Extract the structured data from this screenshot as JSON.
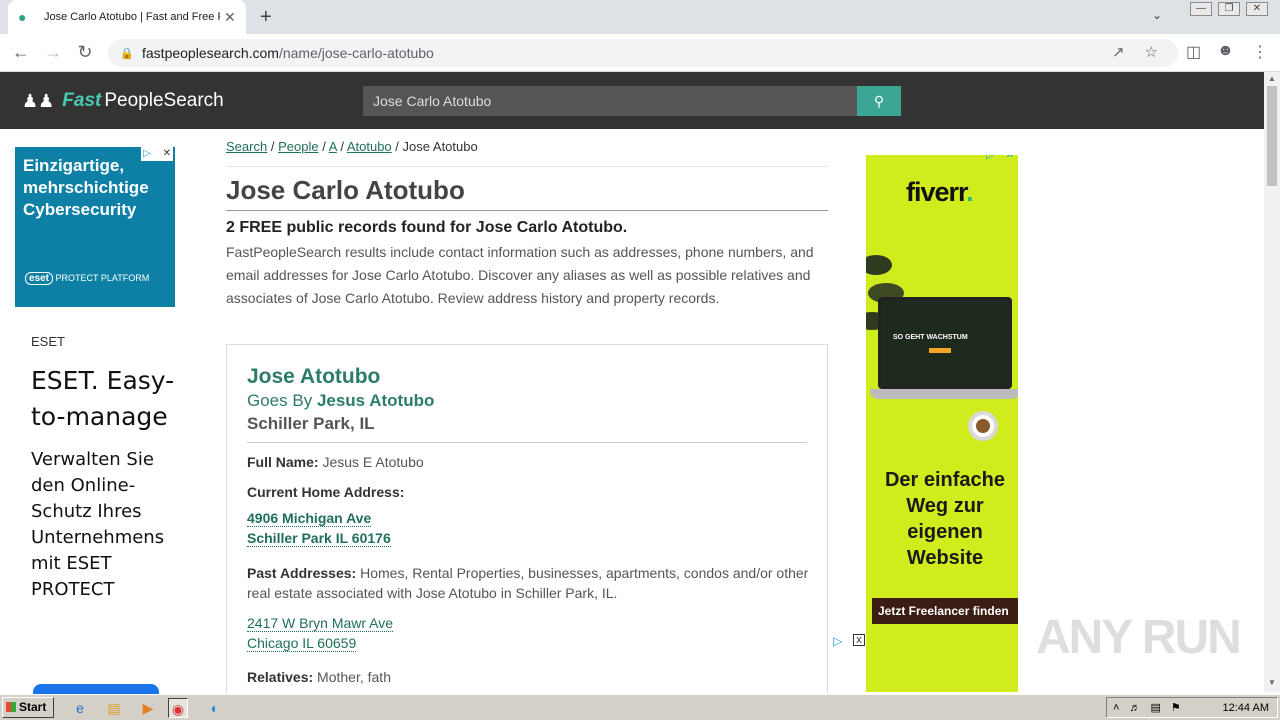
{
  "browser": {
    "tab_title": "Jose Carlo Atotubo | Fast and Free P",
    "url_host": "fastpeoplesearch.com",
    "url_path": "/name/jose-carlo-atotubo"
  },
  "site": {
    "logo_fast": "Fast",
    "logo_rest": "PeopleSearch",
    "search_value": "Jose Carlo Atotubo"
  },
  "breadcrumb": {
    "search": "Search",
    "people": "People",
    "letter": "A",
    "surname": "Atotubo",
    "current": "Jose Atotubo",
    "sep": "/"
  },
  "page": {
    "title": "Jose Carlo Atotubo",
    "subtitle": "2 FREE public records found for Jose Carlo Atotubo.",
    "intro": "FastPeopleSearch results include contact information such as addresses, phone numbers, and email addresses for Jose Carlo Atotubo. Discover any aliases as well as possible relatives and associates of Jose Carlo Atotubo. Review address history and property records."
  },
  "record": {
    "name": "Jose Atotubo",
    "goes_by_label": "Goes By",
    "goes_by_name": "Jesus Atotubo",
    "location": "Schiller Park, IL",
    "full_name_label": "Full Name:",
    "full_name": "Jesus E Atotubo",
    "current_address_label": "Current Home Address:",
    "current_address_line1": "4906 Michigan Ave",
    "current_address_line2": "Schiller Park IL 60176",
    "past_label": "Past Addresses:",
    "past_text": "Homes, Rental Properties, businesses, apartments, condos and/or other real estate associated with Jose Atotubo in Schiller Park, IL.",
    "past_line1": "2417 W Bryn Mawr Ave",
    "past_line2": "Chicago IL 60659",
    "relatives_label": "Relatives:",
    "relatives_text": "Mother, fath"
  },
  "ad_left": {
    "headline": "Einzigartige, mehrschichtige Cybersecurity",
    "logo_badge": "eset",
    "logo_text": "PROTECT PLATFORM",
    "brand": "ESET",
    "big": "ESET. Easy-to-manage",
    "body": "Verwalten Sie den Online-Schutz Ihres Unternehmens mit ESET PROTECT"
  },
  "ad_right": {
    "brand": "fiverr",
    "brand_dot": ".",
    "screen_text": "SO GEHT WACHSTUM",
    "slogan": "Der einfache Weg zur eigenen Website",
    "cta": "Jetzt Freelancer finden"
  },
  "watermark": "ANY RUN",
  "taskbar": {
    "start": "Start",
    "clock": "12:44 AM"
  },
  "colors": {
    "accent": "#2d7c69",
    "header_bg": "#333333",
    "search_btn": "#3aa693",
    "fiverr_bg": "#d1ec1d",
    "eset_bg": "#0e7fa5"
  }
}
